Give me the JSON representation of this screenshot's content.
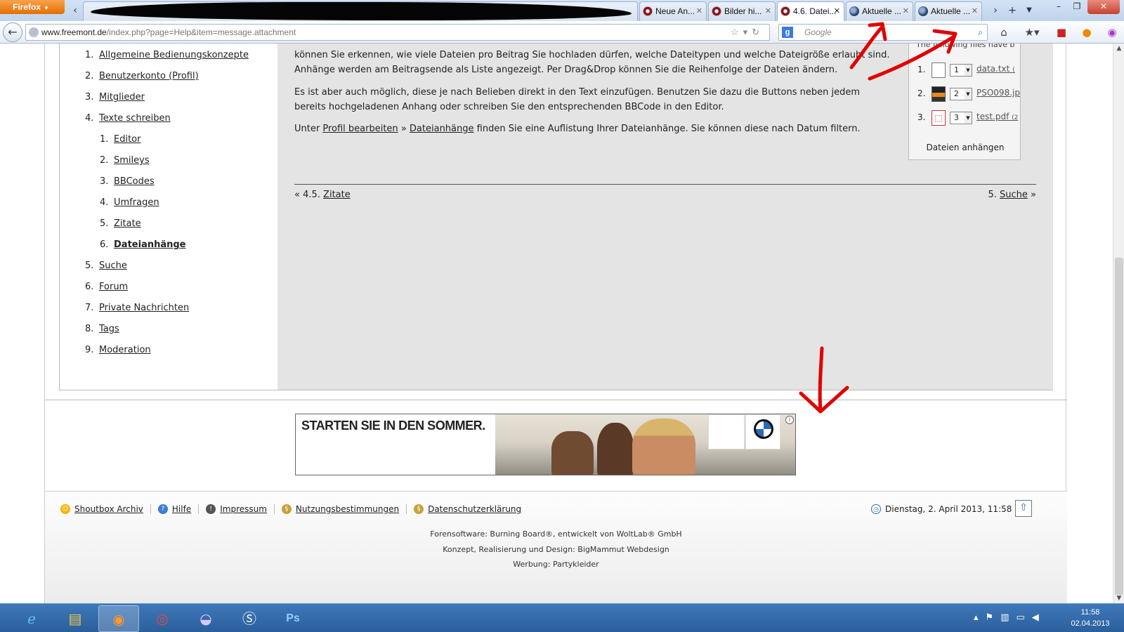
{
  "browser": {
    "menu_label": "Firefox",
    "tabs": [
      {
        "label": "Neue An..."
      },
      {
        "label": "Bilder hi..."
      },
      {
        "label": "4.6. Datei..."
      },
      {
        "label": "Aktuelle ..."
      },
      {
        "label": "Aktuelle ..."
      }
    ],
    "url_domain": "www.freemont.de",
    "url_path": "/index.php?page=Help&item=message.attachment",
    "search_placeholder": "Google"
  },
  "sidebar": {
    "items": [
      {
        "num": "1.",
        "label": "Allgemeine Bedienungskonzepte"
      },
      {
        "num": "2.",
        "label": "Benutzerkonto (Profil)"
      },
      {
        "num": "3.",
        "label": "Mitglieder"
      },
      {
        "num": "4.",
        "label": "Texte schreiben"
      }
    ],
    "subitems": [
      {
        "num": "1.",
        "label": "Editor"
      },
      {
        "num": "2.",
        "label": "Smileys"
      },
      {
        "num": "3.",
        "label": "BBCodes"
      },
      {
        "num": "4.",
        "label": "Umfragen"
      },
      {
        "num": "5.",
        "label": "Zitate"
      },
      {
        "num": "6.",
        "label": "Dateianhänge"
      }
    ],
    "items_after": [
      {
        "num": "5.",
        "label": "Suche"
      },
      {
        "num": "6.",
        "label": "Forum"
      },
      {
        "num": "7.",
        "label": "Private Nachrichten"
      },
      {
        "num": "8.",
        "label": "Tags"
      },
      {
        "num": "9.",
        "label": "Moderation"
      }
    ]
  },
  "main": {
    "para1_line1": "können Sie erkennen, wie viele Dateien pro Beitrag Sie hochladen dürfen, welche Dateitypen und welche Dateigröße erlaubt sind.",
    "para1_line2": "Anhänge werden am Beitragsende als Liste angezeigt. Per Drag&Drop können Sie die Reihenfolge der Dateien ändern.",
    "para2_line1": "Es ist aber auch möglich, diese je nach Belieben direkt in den Text einzufügen. Benutzen Sie dazu die Buttons neben jedem",
    "para2_line2": "bereits hochgeladenen Anhang oder schreiben Sie den entsprechenden BBCode in den Editor.",
    "para3_prefix": "Unter",
    "para3_link1": "Profil bearbeiten",
    "para3_sep": "»",
    "para3_link2": "Dateianhänge",
    "para3_suffix": "finden Sie eine Auflistung Ihrer Dateianhänge. Sie können diese nach Datum filtern.",
    "prev_prefix": "« 4.5.",
    "prev_link": "Zitate",
    "next_prefix": "5.",
    "next_link": "Suche",
    "next_suffix": "»"
  },
  "attachments": {
    "hint": "The following files have b",
    "files": [
      {
        "num": "1.",
        "order": "1",
        "name": "data.txt",
        "extra": "("
      },
      {
        "num": "2.",
        "order": "2",
        "name": "PSO098.jp",
        "extra": ""
      },
      {
        "num": "3.",
        "order": "3",
        "name": "test.pdf",
        "extra": "(2"
      }
    ],
    "button_label": "Dateien anhängen"
  },
  "ad": {
    "headline": "STARTEN SIE IN DEN SOMMER."
  },
  "footer": {
    "links": [
      {
        "label": "Shoutbox Archiv",
        "icon": "smiley-icon"
      },
      {
        "label": "Hilfe",
        "icon": "help-icon"
      },
      {
        "label": "Impressum",
        "icon": "info-icon"
      },
      {
        "label": "Nutzungsbestimmungen",
        "icon": "paragraph-icon"
      },
      {
        "label": "Datenschutzerklärung",
        "icon": "paragraph-icon"
      }
    ],
    "date": "Dienstag, 2. April 2013, 11:58",
    "credit1": "Forensoftware: Burning Board®, entwickelt von WoltLab® GmbH",
    "credit2": "Konzept, Realisierung und Design: BigMammut Webdesign",
    "credit3_prefix": "Werbung:",
    "credit3_link": "Partykleider"
  },
  "taskbar": {
    "time": "11:58",
    "date": "02.04.2013"
  },
  "colors": {
    "annotation": "#e00000",
    "main_bg": "#e4e4e4",
    "taskbar": "#2b5f9c"
  }
}
